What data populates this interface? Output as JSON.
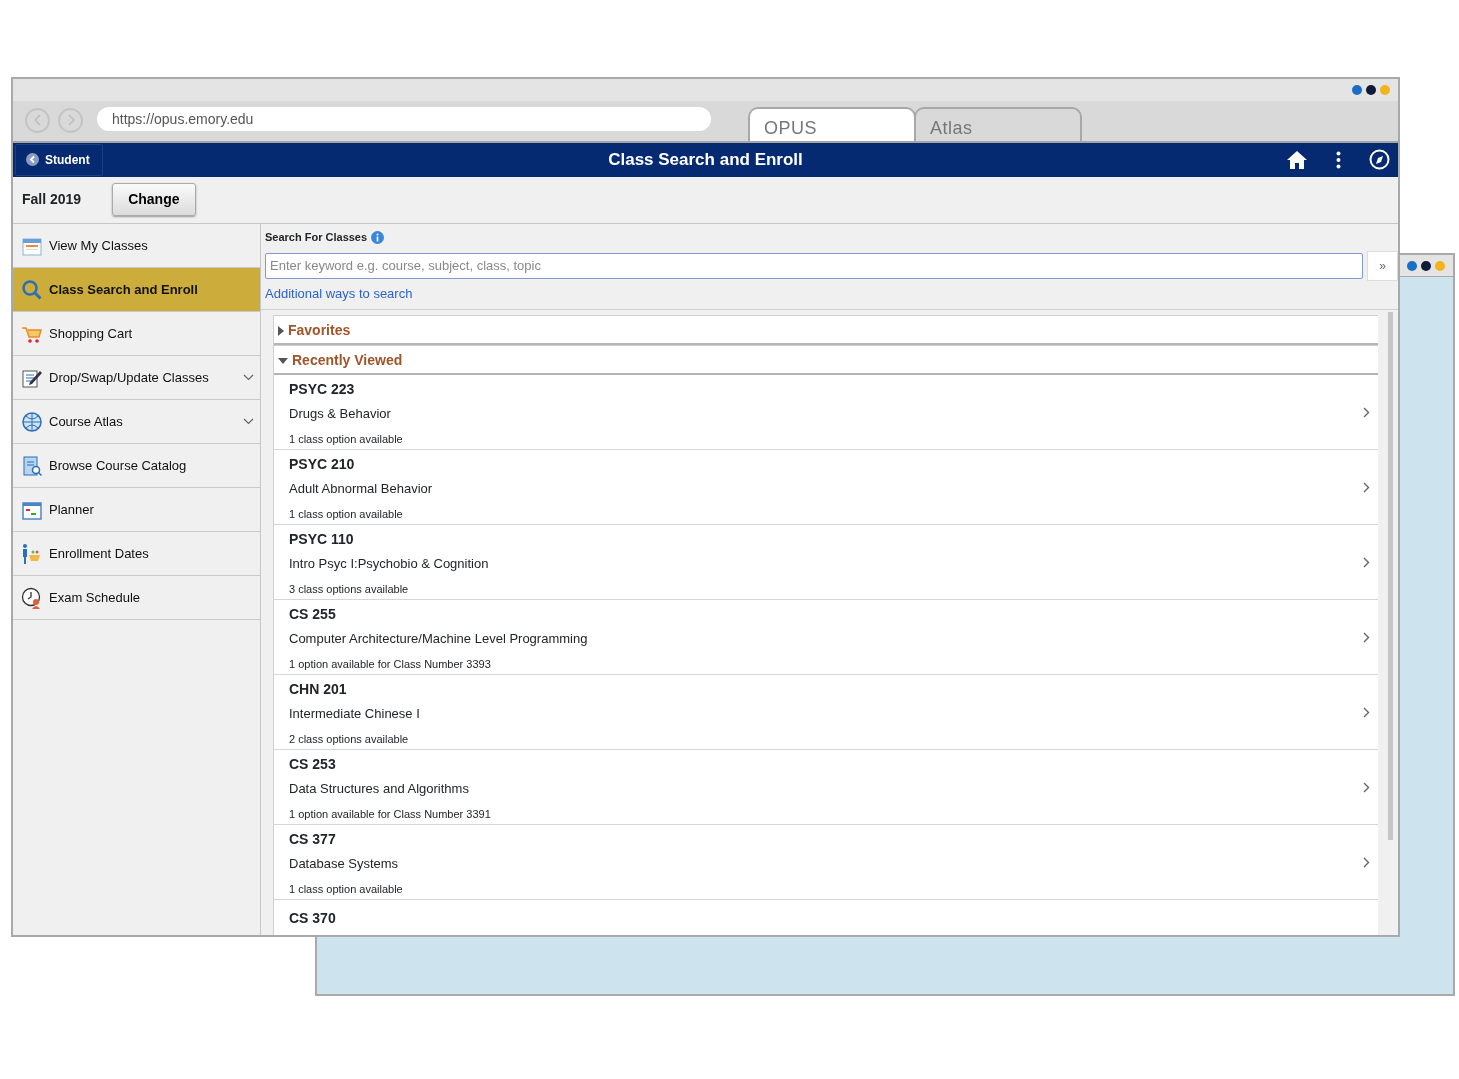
{
  "browser": {
    "url": "https://opus.emory.edu",
    "tabs": [
      {
        "label": "OPUS",
        "selected": true
      },
      {
        "label": "Atlas",
        "selected": false
      }
    ]
  },
  "header": {
    "back_label": "Student",
    "title": "Class Search and Enroll"
  },
  "term": {
    "label": "Fall 2019",
    "button": "Change"
  },
  "sidebar": {
    "items": [
      {
        "label": "View My Classes",
        "kind": "calendar",
        "selected": false,
        "expandable": false
      },
      {
        "label": "Class Search and Enroll",
        "kind": "search",
        "selected": true,
        "expandable": false
      },
      {
        "label": "Shopping Cart",
        "kind": "cart",
        "selected": false,
        "expandable": false
      },
      {
        "label": "Drop/Swap/Update Classes",
        "kind": "edit",
        "selected": false,
        "expandable": true
      },
      {
        "label": "Course Atlas",
        "kind": "globe",
        "selected": false,
        "expandable": true
      },
      {
        "label": "Browse Course Catalog",
        "kind": "catalog",
        "selected": false,
        "expandable": false
      },
      {
        "label": "Planner",
        "kind": "planner",
        "selected": false,
        "expandable": false
      },
      {
        "label": "Enrollment Dates",
        "kind": "person",
        "selected": false,
        "expandable": false
      },
      {
        "label": "Exam Schedule",
        "kind": "clock",
        "selected": false,
        "expandable": false
      }
    ]
  },
  "search": {
    "heading": "Search For Classes",
    "placeholder": "Enter keyword e.g. course, subject, class, topic",
    "go": "»",
    "link": "Additional ways to search"
  },
  "sections": [
    {
      "label": "Favorites",
      "expanded": false
    },
    {
      "label": "Recently Viewed",
      "expanded": true,
      "courses": [
        {
          "code": "PSYC 223",
          "title": "Drugs & Behavior",
          "note": "1 class option available"
        },
        {
          "code": "PSYC 210",
          "title": "Adult Abnormal Behavior",
          "note": "1 class option available"
        },
        {
          "code": "PSYC 110",
          "title": "Intro Psyc I:Psychobio & Cognition",
          "note": "3 class options available"
        },
        {
          "code": "CS 255",
          "title": "Computer Architecture/Machine Level Programming",
          "note": "1 option available for Class Number 3393"
        },
        {
          "code": "CHN 201",
          "title": "Intermediate Chinese I",
          "note": "2 class options available"
        },
        {
          "code": "CS 253",
          "title": "Data Structures and Algorithms",
          "note": "1 option available for Class Number 3391"
        },
        {
          "code": "CS 377",
          "title": "Database Systems",
          "note": "1 class option available"
        },
        {
          "code": "CS 370"
        }
      ]
    }
  ]
}
